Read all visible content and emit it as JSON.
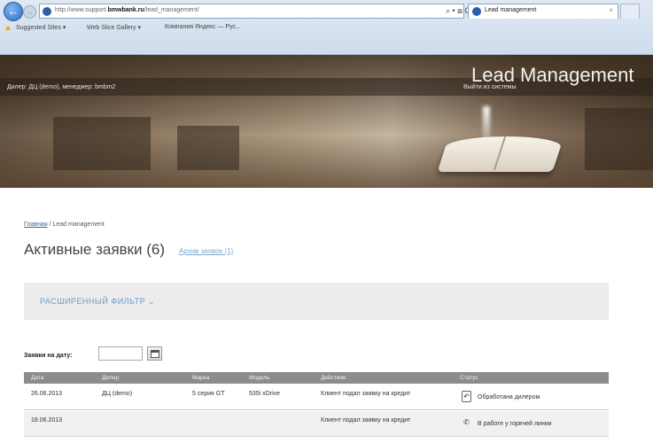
{
  "browser": {
    "url_prefix": "http://www.support.",
    "url_domain": "bmwbank.ru",
    "url_suffix": "/lead_management/",
    "addr_tools": "⌕ • ⊠ C ×",
    "tab_title": "Lead management",
    "tab_close": "×",
    "favorites": [
      "Suggested Sites ▾",
      "Web Slice Gallery ▾",
      "Компания Яндекс — Рус..."
    ]
  },
  "header": {
    "title": "Lead Management",
    "user_info": "Дилер: ДЦ (demo), менеджер: bmbm2",
    "logout": "Выйти из системы"
  },
  "breadcrumb": {
    "home": "Главная",
    "separator": " / ",
    "current": "Lead management"
  },
  "page": {
    "title": "Активные заявки (6)",
    "archive_link": "Архив заявок (1)"
  },
  "filter": {
    "label": "РАСШИРЕННЫЙ ФИЛЬТР ⌄"
  },
  "date_filter": {
    "label": "Заявки на дату:",
    "value": ""
  },
  "table": {
    "headers": [
      "Дата",
      "Дилер",
      "Марка",
      "Модель",
      "Действие",
      "Статус"
    ],
    "rows": [
      {
        "date": "26.06.2013",
        "dealer": "ДЦ (demo)",
        "brand": "5 серия GT",
        "model": "535i xDrive",
        "action": "Клиент подал заявку на кредит",
        "status_icon": "↶",
        "status": "Обработана дилером"
      },
      {
        "date": "18.06.2013",
        "dealer": "",
        "brand": "",
        "model": "",
        "action": "Клиент подал заявку на кредит",
        "status_icon": "✆",
        "status": "В работе у горячей линии"
      }
    ]
  }
}
